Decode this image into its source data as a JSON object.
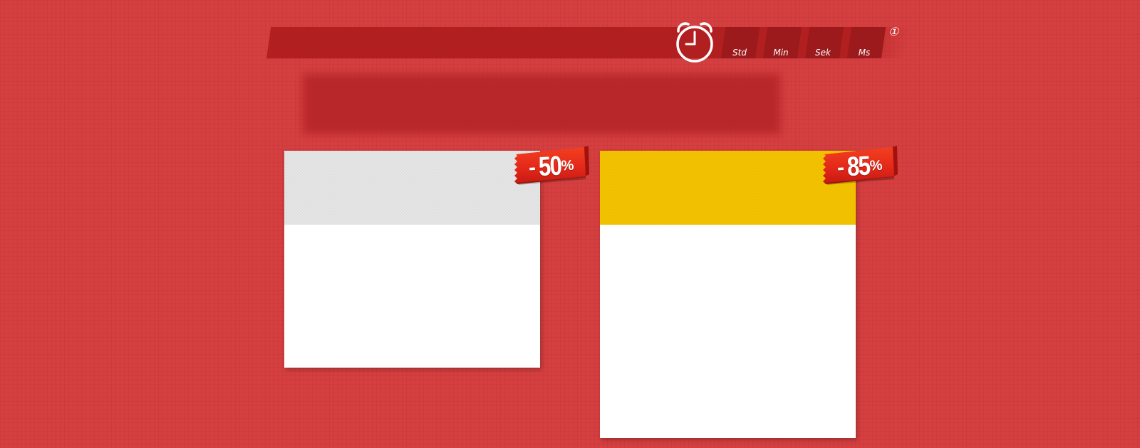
{
  "countdown": {
    "units": [
      {
        "label": "Std"
      },
      {
        "label": "Min"
      },
      {
        "label": "Sek"
      },
      {
        "label": "Ms"
      }
    ],
    "clock_icon": "alarm-clock-icon",
    "info_icon": "info-icon",
    "info_glyph": "①"
  },
  "cards": [
    {
      "discount_value": "50",
      "discount_dash": "-",
      "discount_percent": "%",
      "header_color": "#e6e6e6"
    },
    {
      "discount_value": "85",
      "discount_dash": "-",
      "discount_percent": "%",
      "header_color": "#f5c400"
    }
  ],
  "colors": {
    "background": "#d63f40",
    "bar": "#b21f21",
    "unit_box": "#9c1a1c",
    "ribbon": "#e4281a",
    "card": "#ffffff"
  }
}
